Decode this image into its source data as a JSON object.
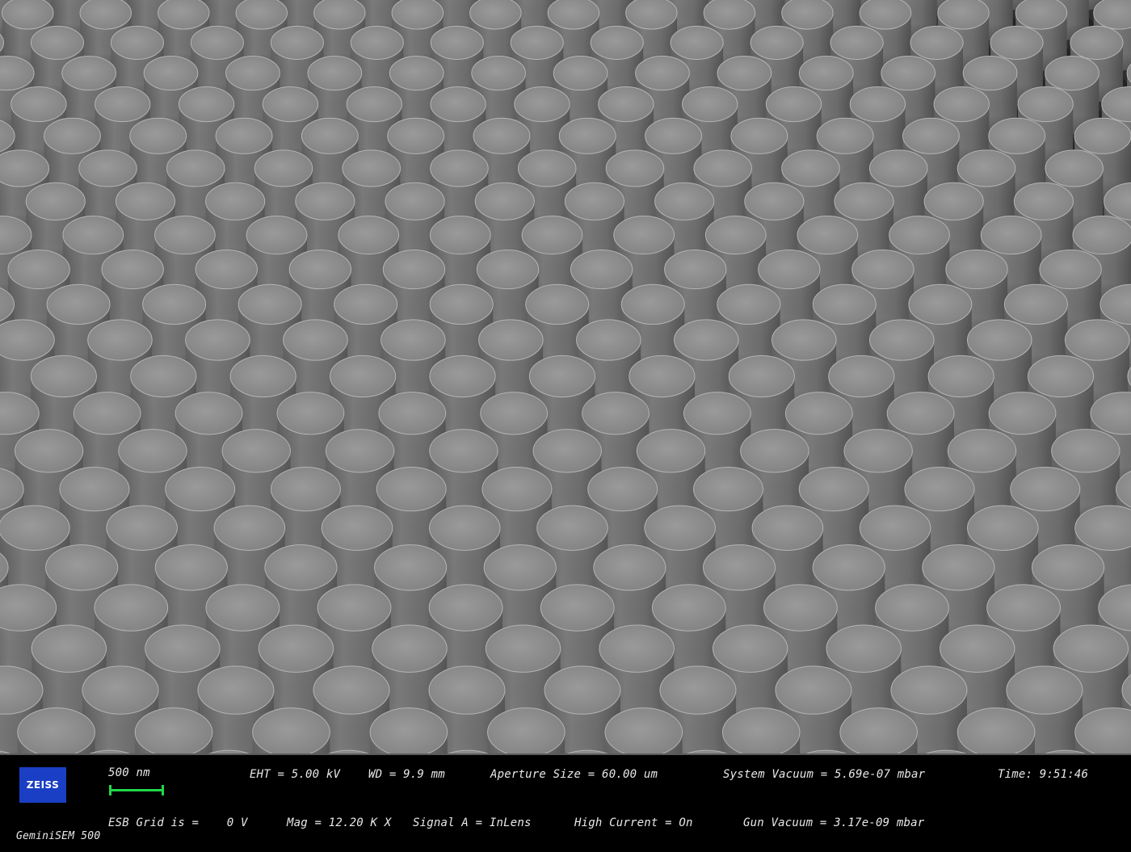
{
  "image": {
    "subject": "sem-micrograph-nanopillar-array",
    "background_color": "#2e2e2e",
    "pillar_top_color": "#8e8e8e",
    "pillar_side_color": "#6e6e6e"
  },
  "info_bar": {
    "logo_text": "ZEISS",
    "logo_color": "#1a3fc4",
    "scale_bar_label": "500 nm",
    "scale_bar_color": "#22d64a",
    "eht": "EHT = 5.00 kV",
    "wd": "WD = 9.9 mm",
    "aperture": "Aperture Size = 60.00 um",
    "system_vacuum": "System Vacuum = 5.69e-07 mbar",
    "time": "Time: 9:51:46",
    "esb_grid": "ESB Grid is =    0 V",
    "mag": "Mag = 12.20 K X",
    "signal": "Signal A = InLens",
    "high_current": "High Current = On",
    "gun_vacuum": "Gun Vacuum = 3.17e-09 mbar",
    "instrument": "GeminiSEM 500"
  }
}
